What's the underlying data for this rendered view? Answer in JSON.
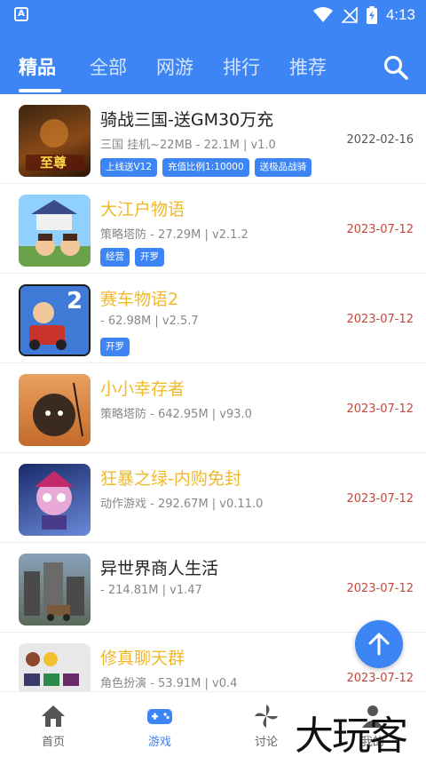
{
  "status_bar": {
    "time": "4:13",
    "app_badge": "A"
  },
  "header": {
    "tabs": [
      {
        "label": "精品",
        "active": true
      },
      {
        "label": "全部",
        "active": false
      },
      {
        "label": "网游",
        "active": false
      },
      {
        "label": "排行",
        "active": false
      },
      {
        "label": "推荐",
        "active": false
      }
    ]
  },
  "games": [
    {
      "title": "骑战三国-送GM30万充",
      "meta": "三国 挂机~22MB - 22.1M | v1.0",
      "date": "2022-02-16",
      "tags": [
        "上线送V12",
        "充值比例1:10000",
        "送极品战骑"
      ],
      "thumb_text": "至尊"
    },
    {
      "title": "大江户物语",
      "meta": "策略塔防 - 27.29M | v2.1.2",
      "date": "2023-07-12",
      "tags": [
        "经营",
        "开罗"
      ]
    },
    {
      "title": "赛车物语2",
      "meta": " - 62.98M | v2.5.7",
      "date": "2023-07-12",
      "tags": [
        "开罗"
      ],
      "thumb_text": "2"
    },
    {
      "title": "小小幸存者",
      "meta": "策略塔防 - 642.95M | v93.0",
      "date": "2023-07-12",
      "tags": []
    },
    {
      "title": "狂暴之绿-内购免封",
      "meta": "动作游戏 - 292.67M | v0.11.0",
      "date": "2023-07-12",
      "tags": []
    },
    {
      "title": "异世界商人生活",
      "meta": " - 214.81M | v1.47",
      "date": "2023-07-12",
      "tags": []
    },
    {
      "title": "修真聊天群",
      "meta": "角色扮演 - 53.91M | v0.4",
      "date": "2023-07-12",
      "tags": []
    }
  ],
  "bottom_nav": {
    "items": [
      {
        "label": "首页",
        "active": false
      },
      {
        "label": "游戏",
        "active": true
      },
      {
        "label": "讨论",
        "active": false
      },
      {
        "label": "我的",
        "active": false
      }
    ]
  },
  "watermark": "大玩客",
  "colors": {
    "primary": "#3d85f5",
    "title_yellow": "#f0b92a",
    "date_red": "#c4483a"
  }
}
